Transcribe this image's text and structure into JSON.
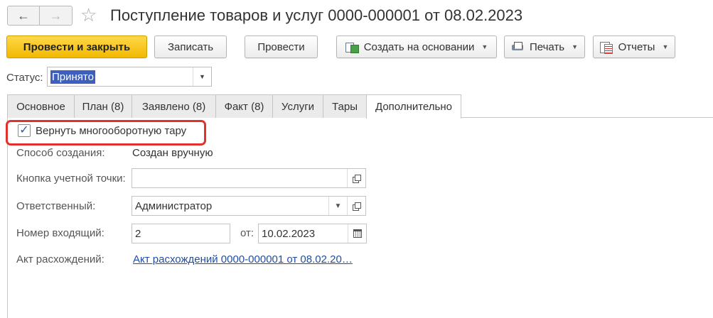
{
  "window": {
    "title": "Поступление товаров и услуг 0000-000001 от 08.02.2023"
  },
  "toolbar": {
    "post_and_close": "Провести и закрыть",
    "save": "Записать",
    "post": "Провести",
    "create_based_on": "Создать на основании",
    "print": "Печать",
    "reports": "Отчеты"
  },
  "status": {
    "label": "Статус:",
    "value": "Принято"
  },
  "tabs": [
    {
      "label": "Основное"
    },
    {
      "label": "План (8)"
    },
    {
      "label": "Заявлено (8)"
    },
    {
      "label": "Факт (8)"
    },
    {
      "label": "Услуги"
    },
    {
      "label": "Тары"
    },
    {
      "label": "Дополнительно"
    }
  ],
  "additional": {
    "return_tare_label": "Вернуть многооборотную тару",
    "return_tare_checked": true,
    "creation_method_label": "Способ создания:",
    "creation_method_value": "Создан вручную",
    "account_point_label": "Кнопка учетной точки:",
    "account_point_value": "",
    "responsible_label": "Ответственный:",
    "responsible_value": "Администратор",
    "incoming_number_label": "Номер входящий:",
    "incoming_number_value": "2",
    "date_from_label": "от:",
    "date_value": "10.02.2023",
    "discrepancy_act_label": "Акт расхождений:",
    "discrepancy_act_link": "Акт расхождений 0000-000001 от 08.02.20…"
  },
  "colors": {
    "primary_button": "#f1b900",
    "highlight_border": "#e0312b",
    "link": "#1f4fa3",
    "selection": "#3d5fbd"
  }
}
